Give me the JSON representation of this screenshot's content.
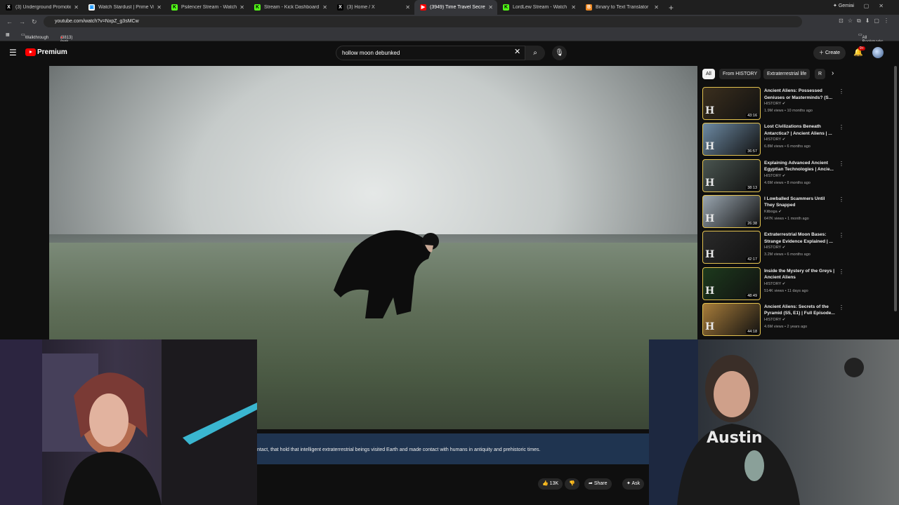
{
  "browser": {
    "tabs": [
      {
        "label": "(3) Underground Promotions o...",
        "fav": "X",
        "favColor": "#000000",
        "favText": "#ffffff"
      },
      {
        "label": "Watch Stardust | Prime Video",
        "fav": "▣",
        "favColor": "#ffffff",
        "favText": "#1a98ff"
      },
      {
        "label": "Psilencer Stream - Watch Live o...",
        "fav": "K",
        "favColor": "#53fc18",
        "favText": "#000000"
      },
      {
        "label": "Stream - Kick Dashboard",
        "fav": "K",
        "favColor": "#53fc18",
        "favText": "#000000"
      },
      {
        "label": "(3) Home / X",
        "fav": "X",
        "favColor": "#000000",
        "favText": "#ffffff"
      },
      {
        "label": "(3949) Time Travel Secrets ...",
        "fav": "▶",
        "favColor": "#ff0000",
        "favText": "#ffffff"
      },
      {
        "label": "LordLew Stream - Watch Live o...",
        "fav": "K",
        "favColor": "#53fc18",
        "favText": "#000000"
      },
      {
        "label": "Binary to Text Translator",
        "fav": "B",
        "favColor": "#f08a24",
        "favText": "#ffffff"
      }
    ],
    "active_tab": 5,
    "gemini_label": "Gemini",
    "url": "youtube.com/watch?v=NxpZ_g3sMCw",
    "bookmarks": [
      {
        "label": "Walkthrough"
      },
      {
        "label": "(3813) mgk - tread..."
      }
    ],
    "all_bookmarks": "All Bookmarks"
  },
  "youtube": {
    "brand": "Premium",
    "search_value": "hollow moon debunked",
    "create_label": "Create",
    "notif_badge": "9+",
    "caption_text": "ntact, that hold that intelligent extraterrestrial beings visited Earth and made contact with humans in antiquity and prehistoric times.",
    "like_count": "13K",
    "share_label": "Share",
    "ask_label": "Ask",
    "chips": [
      "All",
      "From HISTORY",
      "Extraterrestrial life",
      "R"
    ],
    "recommendations": [
      {
        "title": "Ancient Aliens: Possessed Geniuses or Masterminds? (S...",
        "channel": "HISTORY",
        "meta": "1.9M views • 10 months ago",
        "duration": "43:16",
        "thumb": "#3b2f1e"
      },
      {
        "title": "Lost Civilizations Beneath Antarctica? | Ancient Aliens | ...",
        "channel": "HISTORY",
        "meta": "6.8M views • 6 months ago",
        "duration": "36:57",
        "thumb": "#6d8aa3"
      },
      {
        "title": "Explaining Advanced Ancient Egyptian Technologies | Ancie...",
        "channel": "HISTORY",
        "meta": "4.6M views • 8 months ago",
        "duration": "38:13",
        "thumb": "#4a5550"
      },
      {
        "title": "I Lowballed Scammers Until They Snapped",
        "channel": "Kitboga",
        "meta": "647K views • 1 month ago",
        "duration": "26:38",
        "thumb": "#9aa6b0"
      },
      {
        "title": "Extraterrestrial Moon Bases: Strange Evidence Explained | ...",
        "channel": "HISTORY",
        "meta": "3.2M views • 6 months ago",
        "duration": "42:17",
        "thumb": "#2a2a2a"
      },
      {
        "title": "Inside the Mystery of the Greys | Ancient Aliens",
        "channel": "HISTORY",
        "meta": "514K views • 11 days ago",
        "duration": "48:49",
        "thumb": "#1d3a1d"
      },
      {
        "title": "Ancient Aliens: Secrets of the Pyramid (S5, E1) | Full Episode...",
        "channel": "HISTORY",
        "meta": "4.6M views • 2 years ago",
        "duration": "44:18",
        "thumb": "#a77c3a"
      }
    ]
  },
  "webcam_right": {
    "shirt_text": "Austin"
  }
}
